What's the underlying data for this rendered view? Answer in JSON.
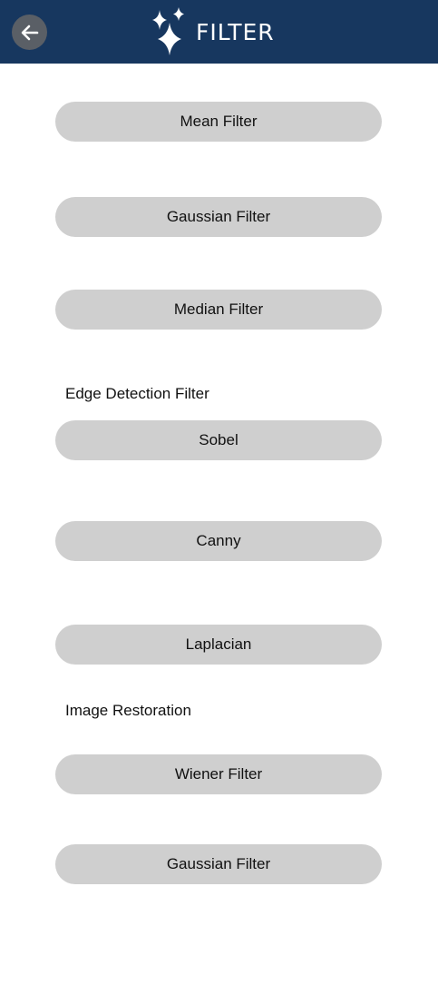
{
  "header": {
    "title": "FILTER",
    "back_icon": "arrow-left-icon",
    "title_icon": "sparkle-icon",
    "background_color": "#17375f"
  },
  "buttons": {
    "mean": "Mean Filter",
    "gaussian": "Gaussian Filter",
    "median": "Median Filter",
    "sobel": "Sobel",
    "canny": "Canny",
    "laplacian": "Laplacian",
    "wiener": "Wiener Filter",
    "gaussian_restoration": "Gaussian Filter"
  },
  "sections": {
    "edge_detection": "Edge Detection Filter",
    "image_restoration": "Image Restoration"
  },
  "colors": {
    "button_bg": "#cfcfcf",
    "text": "#111111"
  }
}
